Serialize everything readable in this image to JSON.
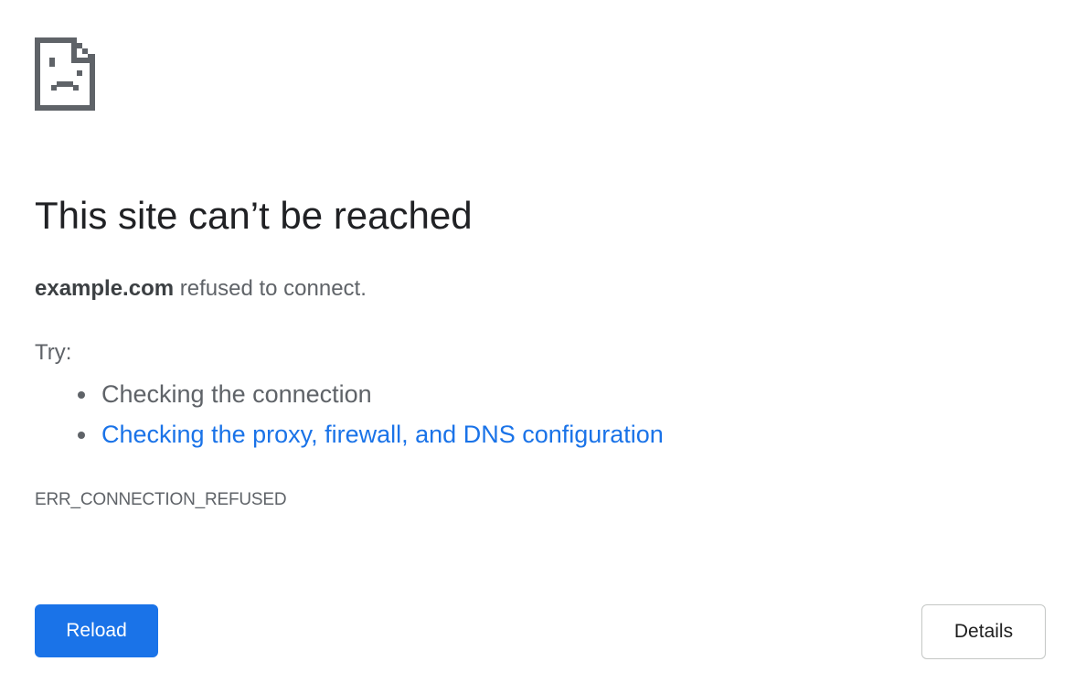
{
  "icon": {
    "name": "sad-page-icon",
    "color": "#5f6368"
  },
  "error": {
    "title": "This site can’t be reached",
    "host": "example.com",
    "summary_rest": " refused to connect.",
    "try_label": "Try:",
    "suggestions": [
      {
        "label": "Checking the connection",
        "link": false
      },
      {
        "label": "Checking the proxy, firewall, and DNS configuration",
        "link": true
      }
    ],
    "code": "ERR_CONNECTION_REFUSED"
  },
  "buttons": {
    "reload_label": "Reload",
    "details_label": "Details"
  },
  "colors": {
    "accent": "#1a73e8",
    "text_primary": "#202124",
    "text_secondary": "#5f6368"
  }
}
